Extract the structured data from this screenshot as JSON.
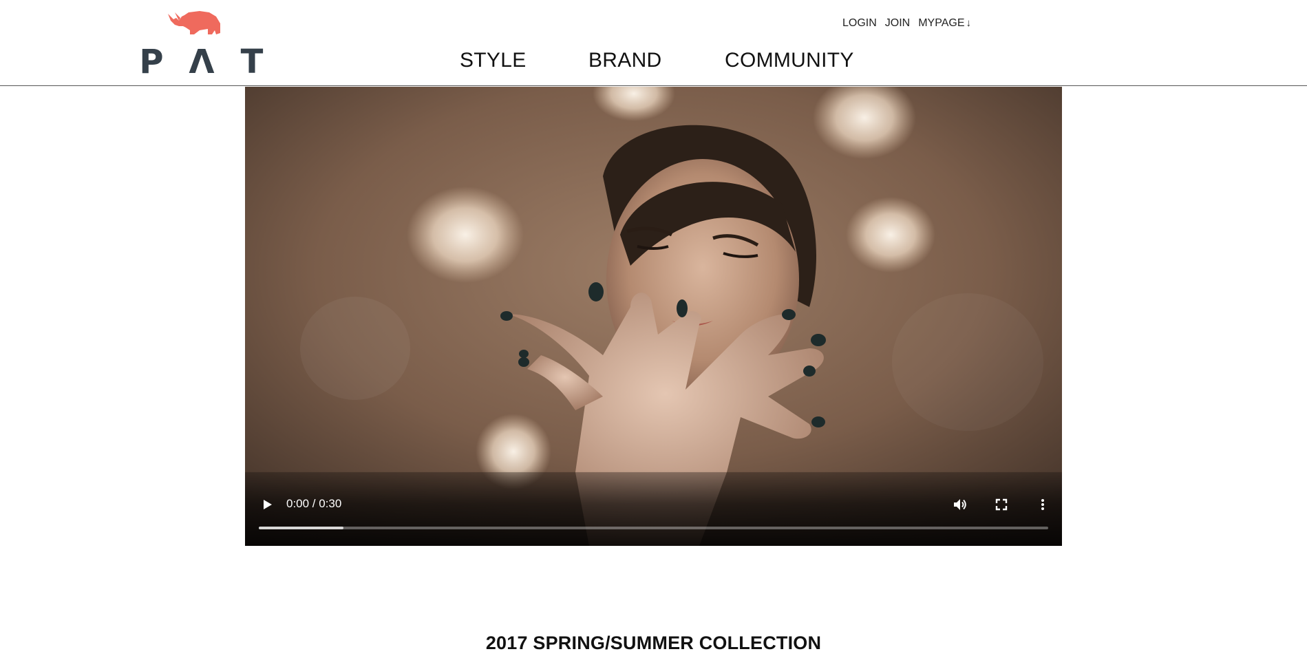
{
  "brand": {
    "logo_text": [
      "P",
      "Λ",
      "T"
    ],
    "logo_color": "#35404a",
    "mark_color": "#ef6a5d",
    "mark_icon": "rhino-icon"
  },
  "main_nav": [
    {
      "label": "STYLE"
    },
    {
      "label": "BRAND"
    },
    {
      "label": "COMMUNITY"
    }
  ],
  "util_nav": {
    "login": "LOGIN",
    "join": "JOIN",
    "mypage": "MYPAGE",
    "mypage_arrow": "↓"
  },
  "video": {
    "time_display": "0:00 / 0:30",
    "buffered_fraction": 0.107,
    "icons": [
      "play-icon",
      "volume-icon",
      "fullscreen-icon",
      "more-options-icon"
    ]
  },
  "collection": {
    "title": "2017 SPRING/SUMMER COLLECTION"
  }
}
